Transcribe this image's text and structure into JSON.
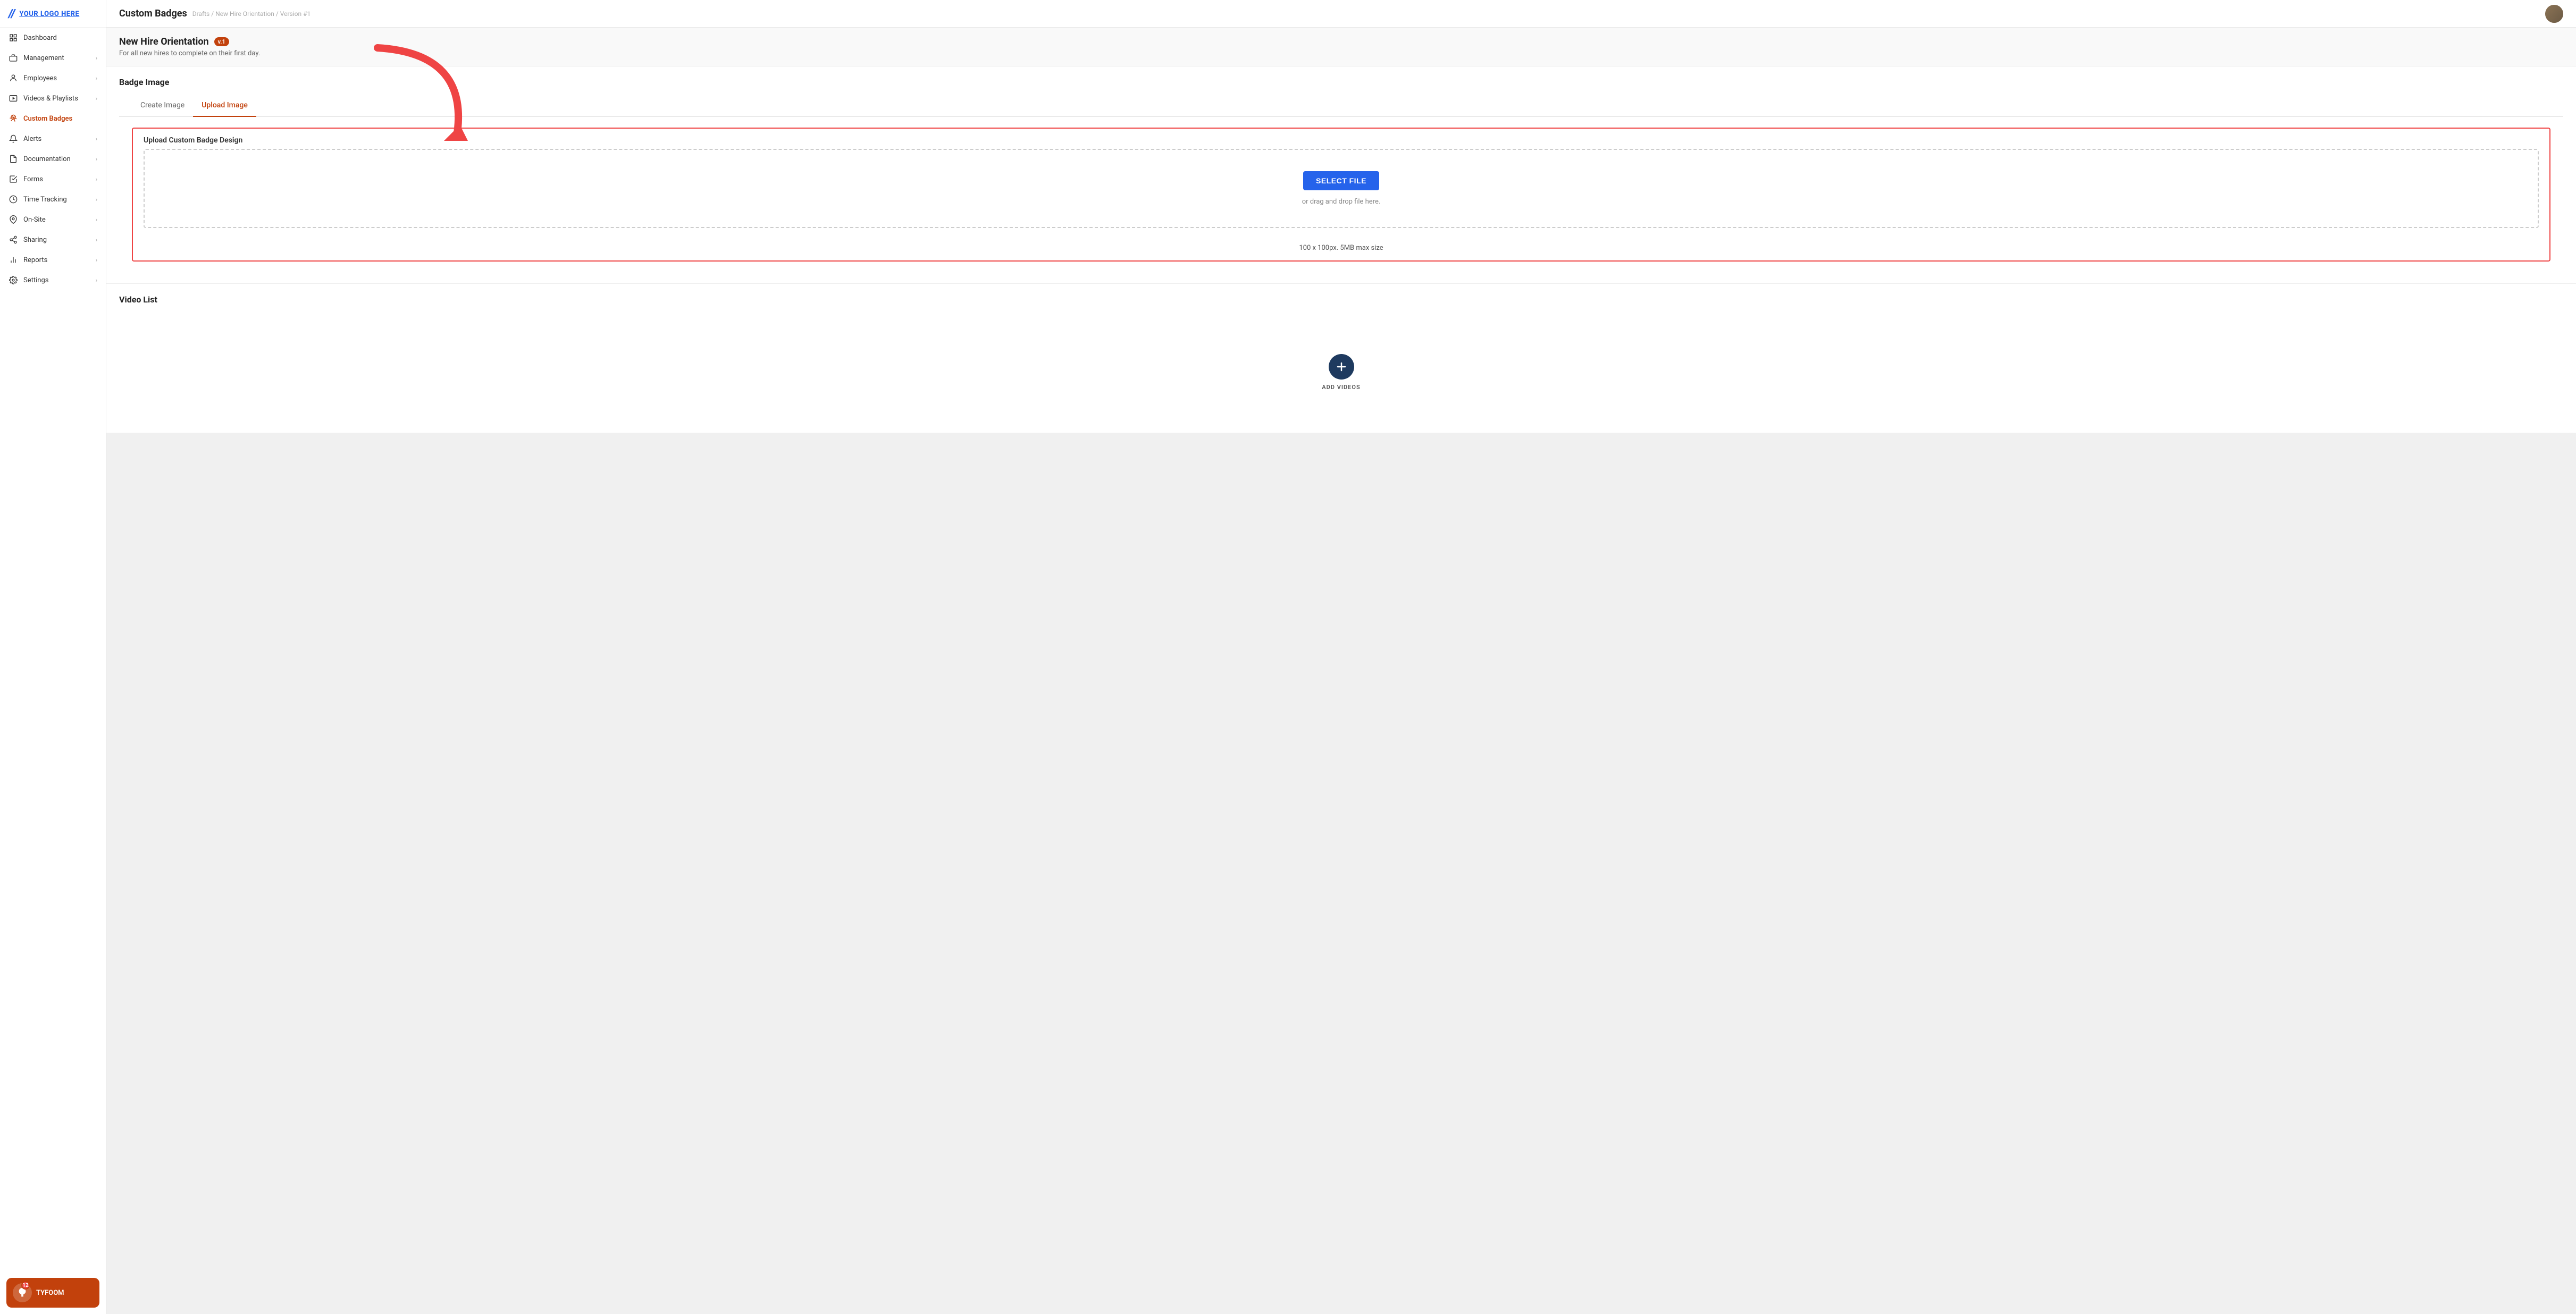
{
  "logo": {
    "icon": "//",
    "text": "YOUR LOGO HERE"
  },
  "nav": {
    "items": [
      {
        "id": "dashboard",
        "label": "Dashboard",
        "icon": "grid",
        "hasChevron": false
      },
      {
        "id": "management",
        "label": "Management",
        "icon": "briefcase",
        "hasChevron": true
      },
      {
        "id": "employees",
        "label": "Employees",
        "icon": "person",
        "hasChevron": true
      },
      {
        "id": "videos-playlists",
        "label": "Videos & Playlists",
        "icon": "play",
        "hasChevron": true
      },
      {
        "id": "custom-badges",
        "label": "Custom Badges",
        "icon": "badge",
        "hasChevron": false,
        "active": true
      },
      {
        "id": "alerts",
        "label": "Alerts",
        "icon": "bell",
        "hasChevron": true
      },
      {
        "id": "documentation",
        "label": "Documentation",
        "icon": "doc",
        "hasChevron": true
      },
      {
        "id": "forms",
        "label": "Forms",
        "icon": "form",
        "hasChevron": true
      },
      {
        "id": "time-tracking",
        "label": "Time Tracking",
        "icon": "clock",
        "hasChevron": true
      },
      {
        "id": "on-site",
        "label": "On-Site",
        "icon": "location",
        "hasChevron": true
      },
      {
        "id": "sharing",
        "label": "Sharing",
        "icon": "share",
        "hasChevron": true
      },
      {
        "id": "reports",
        "label": "Reports",
        "icon": "chart",
        "hasChevron": true
      },
      {
        "id": "settings",
        "label": "Settings",
        "icon": "gear",
        "hasChevron": true
      }
    ]
  },
  "notification": {
    "badge_count": "12",
    "label": "TYFOOM"
  },
  "header": {
    "page_title": "Custom Badges",
    "breadcrumb": "Drafts / New Hire Orientation / Version #1"
  },
  "badge_detail": {
    "name": "New Hire Orientation",
    "version": "v.1",
    "description": "For all new hires to complete on their first day."
  },
  "badge_image_section": {
    "title": "Badge Image",
    "tabs": [
      {
        "id": "create-image",
        "label": "Create Image"
      },
      {
        "id": "upload-image",
        "label": "Upload Image",
        "active": true
      }
    ],
    "upload": {
      "box_title": "Upload Custom Badge Design",
      "select_file_label": "SELECT FILE",
      "drag_drop_text": "or drag and drop file here.",
      "size_info": "100 x 100px. 5MB max size"
    }
  },
  "video_list_section": {
    "title": "Video List",
    "add_videos_label": "ADD VIDEOS"
  }
}
